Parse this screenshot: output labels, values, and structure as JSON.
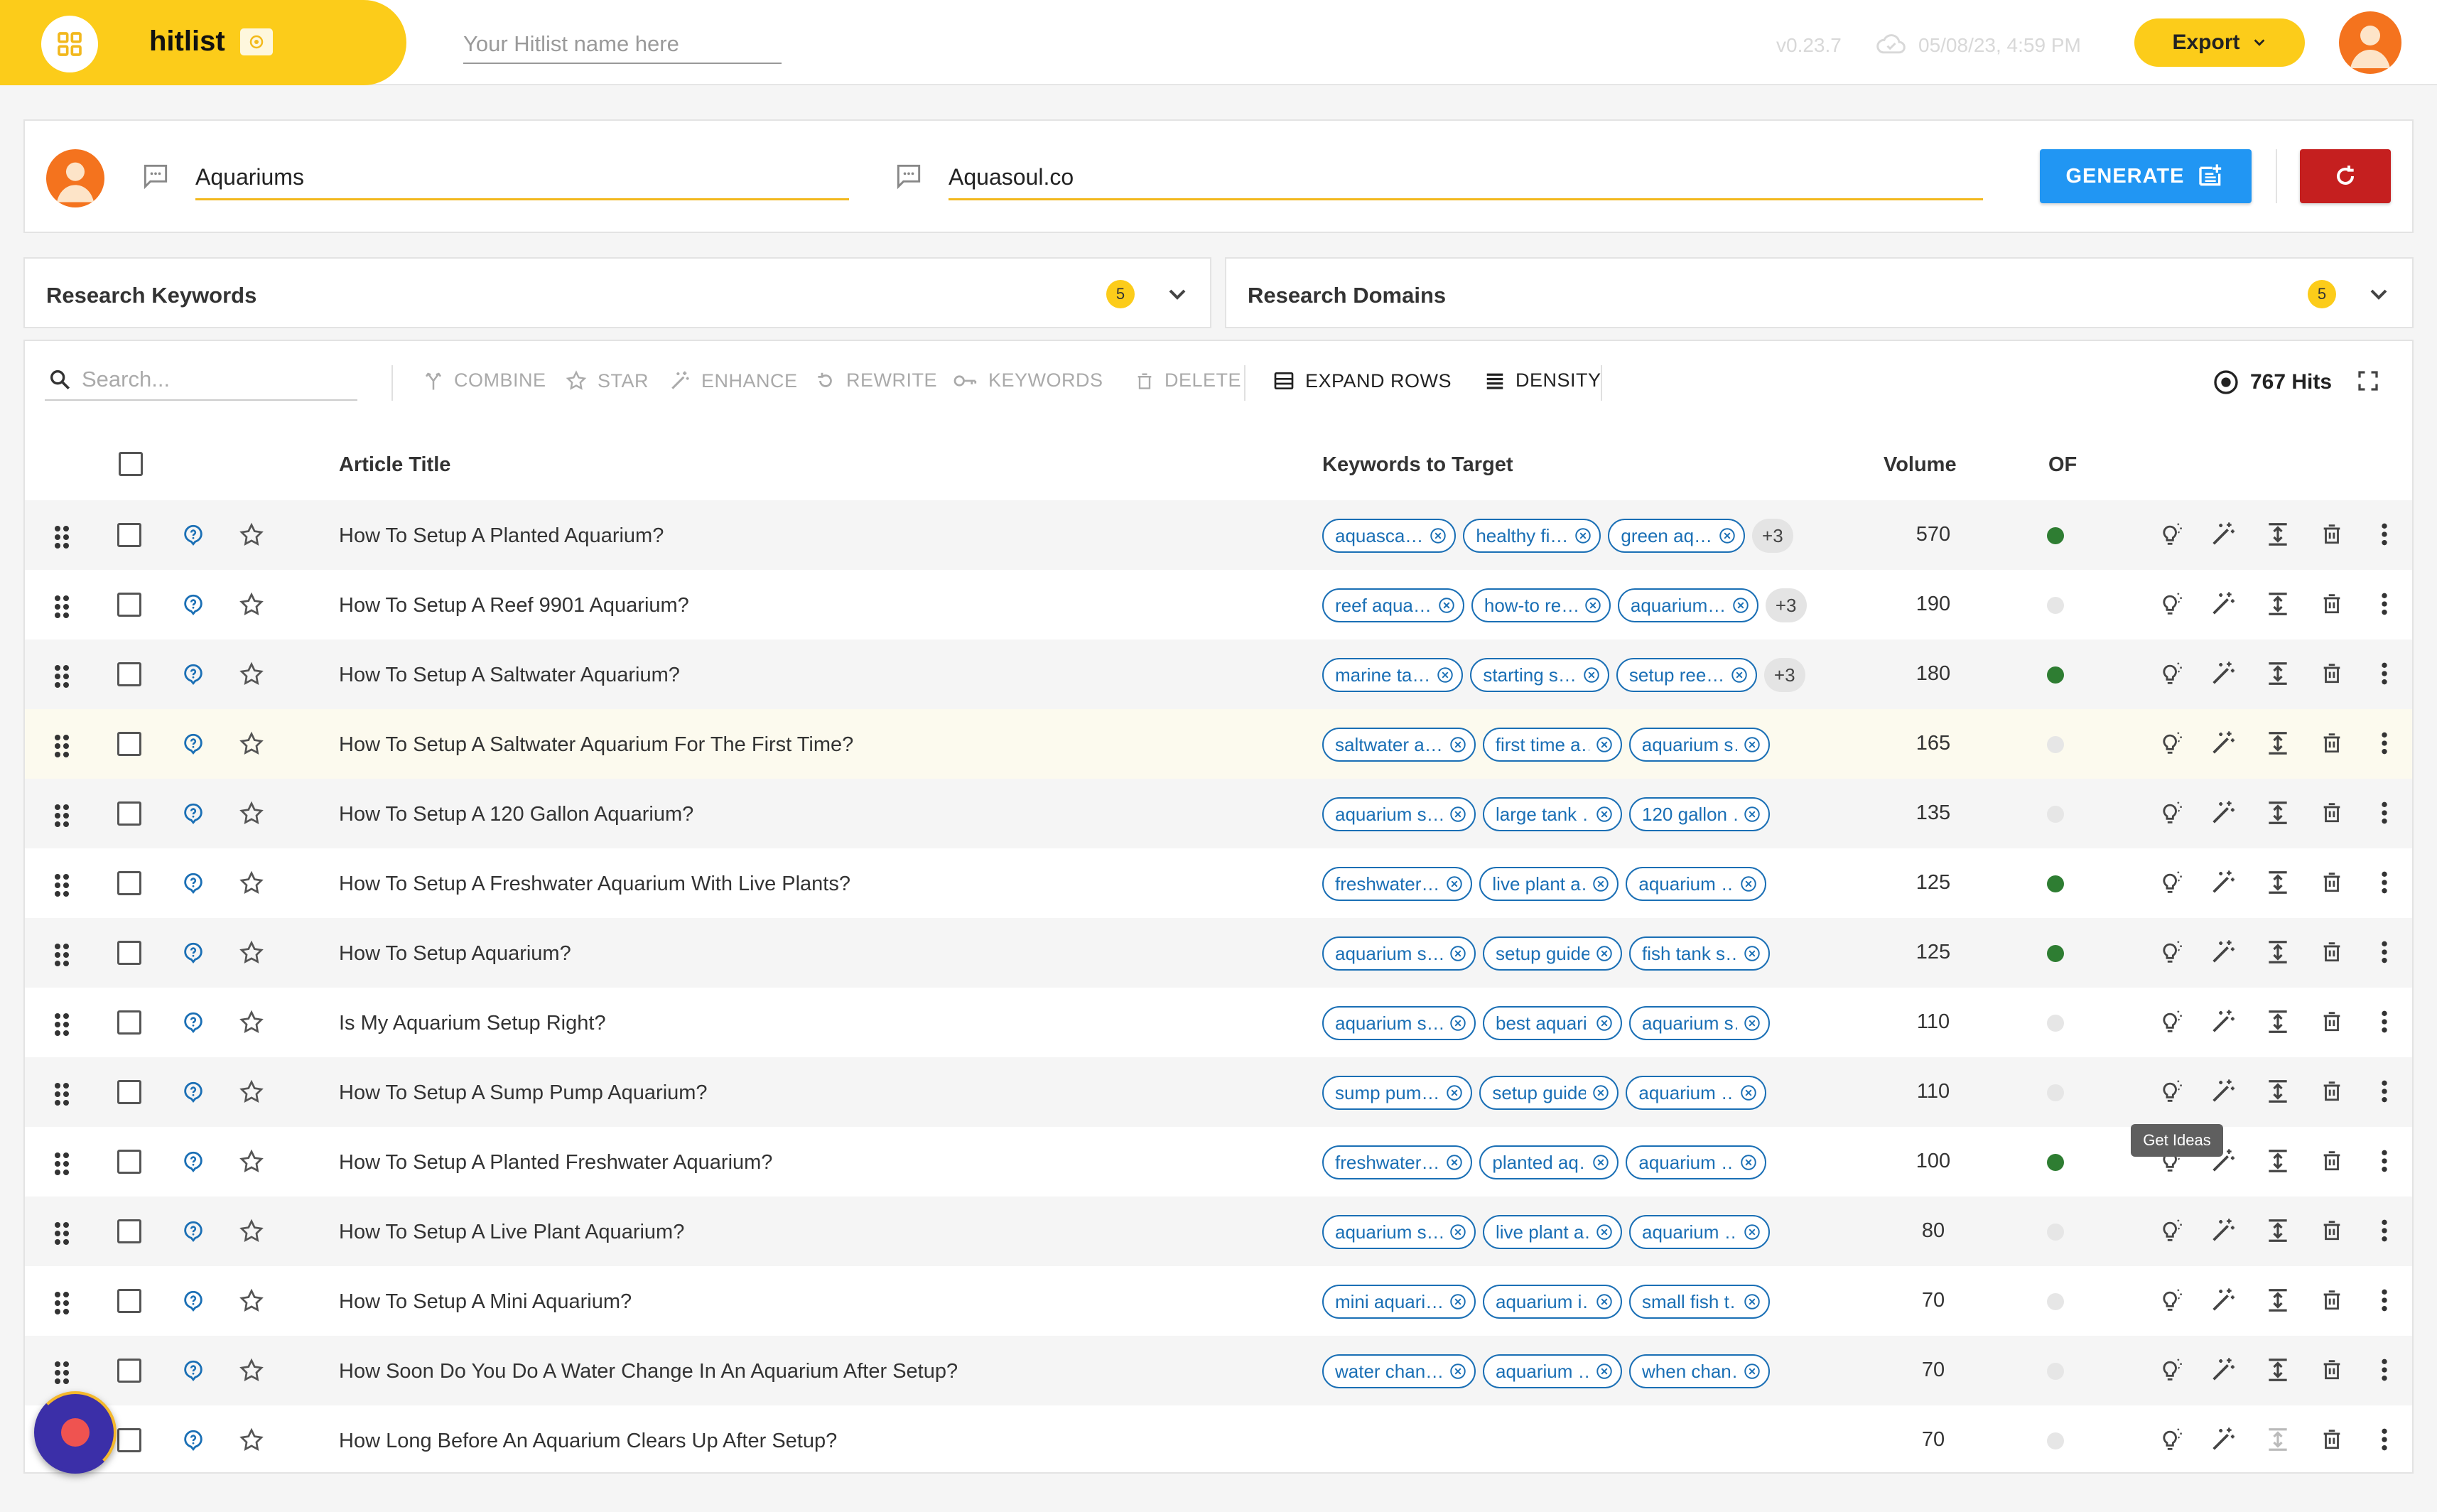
{
  "app": {
    "name": "hitlist"
  },
  "topbar": {
    "hitlist_name_placeholder": "Your Hitlist name here",
    "version": "v0.23.7",
    "saved_time": "05/08/23, 4:59 PM",
    "export_label": "Export"
  },
  "generate": {
    "topic_value": "Aquariums",
    "domain_value": "Aquasoul.co",
    "generate_label": "GENERATE"
  },
  "research": {
    "keywords": {
      "title": "Research Keywords",
      "count": "5"
    },
    "domains": {
      "title": "Research Domains",
      "count": "5"
    }
  },
  "toolbar": {
    "search_placeholder": "Search...",
    "combine": "COMBINE",
    "star": "STAR",
    "enhance": "ENHANCE",
    "rewrite": "REWRITE",
    "keywords": "KEYWORDS",
    "delete": "DELETE",
    "expand_rows": "EXPAND ROWS",
    "density": "DENSITY",
    "hits": "767 Hits"
  },
  "columns": {
    "article_title": "Article Title",
    "keywords_to_target": "Keywords to Target",
    "volume": "Volume",
    "of": "OF"
  },
  "tooltip": "Get Ideas",
  "colors": {
    "brand_yellow": "#fccc1a",
    "generate_blue": "#2196f3",
    "reset_red": "#c51f1f",
    "chip_blue": "#1a6fb5",
    "of_green": "#2e7d32"
  },
  "rows": [
    {
      "title": "How To Setup A Planted Aquarium?",
      "volume": "570",
      "of": true,
      "more": "+3",
      "keywords": [
        "aquasca…",
        "healthy fi…",
        "green aq…"
      ]
    },
    {
      "title": "How To Setup A Reef 9901 Aquarium?",
      "volume": "190",
      "of": false,
      "more": "+3",
      "keywords": [
        "reef aqua…",
        "how-to re…",
        "aquarium…"
      ]
    },
    {
      "title": "How To Setup A Saltwater Aquarium?",
      "volume": "180",
      "of": true,
      "more": "+3",
      "keywords": [
        "marine ta…",
        "starting s…",
        "setup ree…"
      ]
    },
    {
      "title": "How To Setup A Saltwater Aquarium For The First Time?",
      "volume": "165",
      "of": false,
      "more": "",
      "keywords": [
        "saltwater a…",
        "first time a…",
        "aquarium s…"
      ]
    },
    {
      "title": "How To Setup A 120 Gallon Aquarium?",
      "volume": "135",
      "of": false,
      "more": "",
      "keywords": [
        "aquarium s…",
        "large tank …",
        "120 gallon …"
      ]
    },
    {
      "title": "How To Setup A Freshwater Aquarium With Live Plants?",
      "volume": "125",
      "of": true,
      "more": "",
      "keywords": [
        "freshwater…",
        "live plant a…",
        "aquarium …"
      ]
    },
    {
      "title": "How To Setup Aquarium?",
      "volume": "125",
      "of": true,
      "more": "",
      "keywords": [
        "aquarium s…",
        "setup guide",
        "fish tank s…"
      ]
    },
    {
      "title": "Is My Aquarium Setup Right?",
      "volume": "110",
      "of": false,
      "more": "",
      "keywords": [
        "aquarium s…",
        "best aquari…",
        "aquarium s…"
      ]
    },
    {
      "title": "How To Setup A Sump Pump Aquarium?",
      "volume": "110",
      "of": false,
      "more": "",
      "keywords": [
        "sump pum…",
        "setup guide",
        "aquarium …"
      ]
    },
    {
      "title": "How To Setup A Planted Freshwater Aquarium?",
      "volume": "100",
      "of": true,
      "more": "",
      "keywords": [
        "freshwater…",
        "planted aq…",
        "aquarium …"
      ]
    },
    {
      "title": "How To Setup A Live Plant Aquarium?",
      "volume": "80",
      "of": false,
      "more": "",
      "keywords": [
        "aquarium s…",
        "live plant a…",
        "aquarium …"
      ]
    },
    {
      "title": "How To Setup A Mini Aquarium?",
      "volume": "70",
      "of": false,
      "more": "",
      "keywords": [
        "mini aquari…",
        "aquarium i…",
        "small fish t…"
      ]
    },
    {
      "title": "How Soon Do You Do A Water Change In An Aquarium After Setup?",
      "volume": "70",
      "of": false,
      "more": "",
      "keywords": [
        "water chan…",
        "aquarium …",
        "when chan…"
      ]
    },
    {
      "title": "How Long Before An Aquarium Clears Up After Setup?",
      "volume": "70",
      "of": false,
      "more": "",
      "keywords": []
    }
  ]
}
